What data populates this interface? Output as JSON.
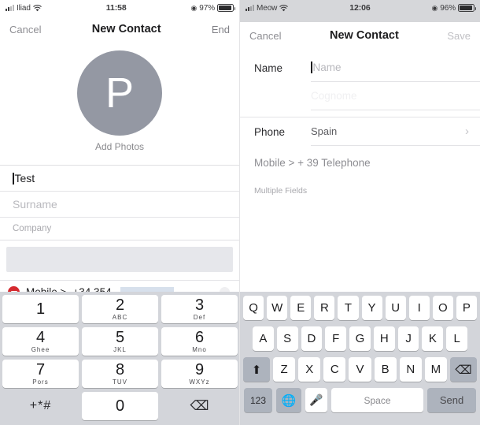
{
  "left": {
    "status": {
      "carrier": "Iliad",
      "time": "11:58",
      "battery_pct": "97%",
      "wifi_icon": "wifi-icon",
      "signal_icon": "signal-bars-icon",
      "location_icon": "location-arrow-icon"
    },
    "nav": {
      "cancel": "Cancel",
      "title": "New Contact",
      "done": "End"
    },
    "avatar": {
      "initial": "P",
      "add_photos": "Add Photos"
    },
    "fields": [
      {
        "name": "first-name",
        "value": "Test",
        "placeholder": ""
      },
      {
        "name": "surname",
        "value": "",
        "placeholder": "Surname"
      },
      {
        "name": "company",
        "value": "",
        "placeholder": "Company"
      }
    ],
    "phone": {
      "delete_icon": "minus-circle-icon",
      "label": "Mobile >",
      "number": "+34 354",
      "redacted": true,
      "clear_icon": "clear-field-icon",
      "add_icon": "plus-circle-icon"
    },
    "keypad": [
      {
        "num": "1",
        "sub": ""
      },
      {
        "num": "2",
        "sub": "ABC"
      },
      {
        "num": "3",
        "sub": "Def"
      },
      {
        "num": "4",
        "sub": "Ghee"
      },
      {
        "num": "5",
        "sub": "JKL"
      },
      {
        "num": "6",
        "sub": "Mno"
      },
      {
        "num": "7",
        "sub": "Pors"
      },
      {
        "num": "8",
        "sub": "TUV"
      },
      {
        "num": "9",
        "sub": "WXYz"
      },
      {
        "num": "+*#",
        "sub": ""
      },
      {
        "num": "0",
        "sub": ""
      },
      {
        "num": "backspace-icon",
        "sub": ""
      }
    ]
  },
  "right": {
    "status": {
      "carrier": "Meow",
      "time": "12:06",
      "battery_pct": "96%",
      "wifi_icon": "wifi-icon",
      "signal_icon": "signal-bars-icon",
      "location_icon": "location-arrow-icon"
    },
    "nav": {
      "cancel": "Cancel",
      "title": "New Contact",
      "save": "Save"
    },
    "form": {
      "name_label": "Name",
      "name_placeholder": "Name",
      "surname_placeholder": "Cognome",
      "phone_label": "Phone",
      "phone_country": "Spain",
      "chevron_icon": "chevron-right-icon",
      "mobile_row": "Mobile > + 39 Telephone",
      "multiple_fields": "Multiple Fields"
    },
    "keyboard": {
      "row1": [
        "Q",
        "W",
        "E",
        "R",
        "T",
        "Y",
        "U",
        "I",
        "O",
        "P"
      ],
      "row2": [
        "A",
        "S",
        "D",
        "F",
        "G",
        "H",
        "J",
        "K",
        "L"
      ],
      "row3": [
        "Z",
        "X",
        "C",
        "V",
        "B",
        "N",
        "M"
      ],
      "shift_icon": "shift-arrow-icon",
      "backspace_icon": "backspace-icon",
      "numbers_key": "123",
      "globe_icon": "globe-icon",
      "mic_icon": "microphone-icon",
      "space": "Space",
      "send": "Send"
    }
  },
  "colors": {
    "avatar_gray": "#9498a3",
    "minus_red": "#d5292f",
    "plus_green": "#3a9d4a",
    "keyboard_bg": "#d3d5da",
    "key_dark": "#adb3bd"
  }
}
